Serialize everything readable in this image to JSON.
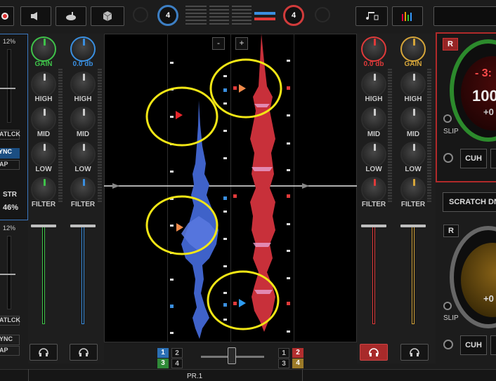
{
  "topbar": {
    "loop_count_left": "4",
    "loop_count_right": "4"
  },
  "left_deck": {
    "pitch_top": "12%",
    "pitch_bottom": "12%",
    "batlck": "ATLCK",
    "sync": "YNC",
    "tap": "AP",
    "str_label": "STR",
    "str_value": "46%",
    "batlck2": "ATLCK",
    "sync2": "YNC",
    "tap2": "AP"
  },
  "mixer_left": {
    "ch1_gain": "GAIN",
    "ch2_gain": "0.0 db",
    "high": "HIGH",
    "mid": "MID",
    "low": "LOW",
    "filter": "FILTER"
  },
  "mixer_right": {
    "ch3_gain": "0.0 db",
    "ch4_gain": "GAIN",
    "high": "HIGH",
    "mid": "MID",
    "low": "LOW",
    "filter": "FILTER"
  },
  "waveform": {
    "zoom_out": "-",
    "zoom_in": "+"
  },
  "deck_select": {
    "left": [
      "1",
      "2",
      "3",
      "4"
    ],
    "right": [
      "1",
      "2",
      "3",
      "4"
    ]
  },
  "right_deck": {
    "rec": "R",
    "time": "- 3:",
    "bpm": "100",
    "offset": "+0",
    "slip": "SLIP",
    "cue": "CUH",
    "scratch": "SCRATCH DNA",
    "rec2": "R",
    "offset2": "+0",
    "slip2": "SLIP",
    "cue2": "CUH"
  },
  "bottombar": {
    "label": "PR.1"
  },
  "colors": {
    "ch1_accent": "#3fc24a",
    "ch2_accent": "#3a8fe0",
    "ch3_accent": "#e03a3a",
    "ch4_accent": "#d6a63a",
    "highlight": "#f2e615"
  }
}
